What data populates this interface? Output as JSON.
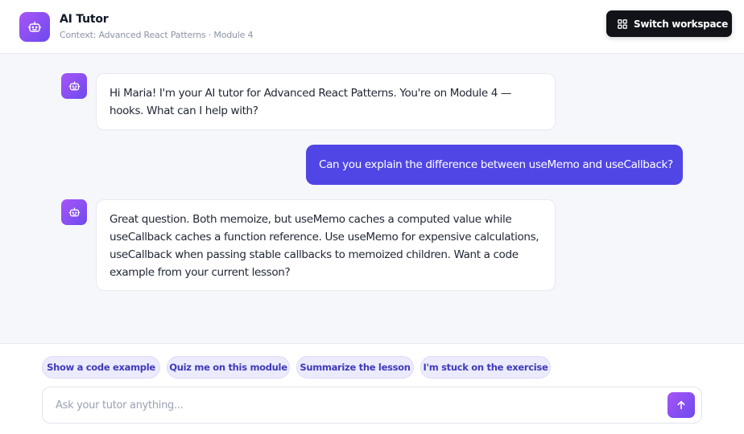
{
  "header": {
    "title": "AI Tutor",
    "context": "Context: Advanced React Patterns · Module 4",
    "switch_button_label": "Switch workspace"
  },
  "messages": [
    {
      "role": "assistant",
      "text": "Hi Maria! I'm your AI tutor for Advanced React Patterns. You're on Module 4 — hooks. What can I help with?"
    },
    {
      "role": "user",
      "text": "Can you explain the difference between useMemo and useCallback?"
    },
    {
      "role": "assistant",
      "text": "Great question. Both memoize, but useMemo caches a computed value while useCallback caches a function reference. Use useMemo for expensive calculations, useCallback when passing stable callbacks to memoized children. Want a code example from your current lesson?"
    }
  ],
  "suggestions": [
    "Show a code example",
    "Quiz me on this module",
    "Summarize the lesson",
    "I'm stuck on the exercise"
  ],
  "composer": {
    "placeholder": "Ask your tutor anything...",
    "value": ""
  },
  "icons": {
    "brand": "robot-icon",
    "switch": "grid-icon",
    "send": "arrow-up-icon"
  },
  "colors": {
    "accent": "#5046e5",
    "avatar_gradient_start": "#a855f7",
    "avatar_gradient_end": "#6d4aee",
    "chip_bg": "#ecebfd",
    "chip_text": "#3f3ab8",
    "dark_button": "#111318"
  }
}
